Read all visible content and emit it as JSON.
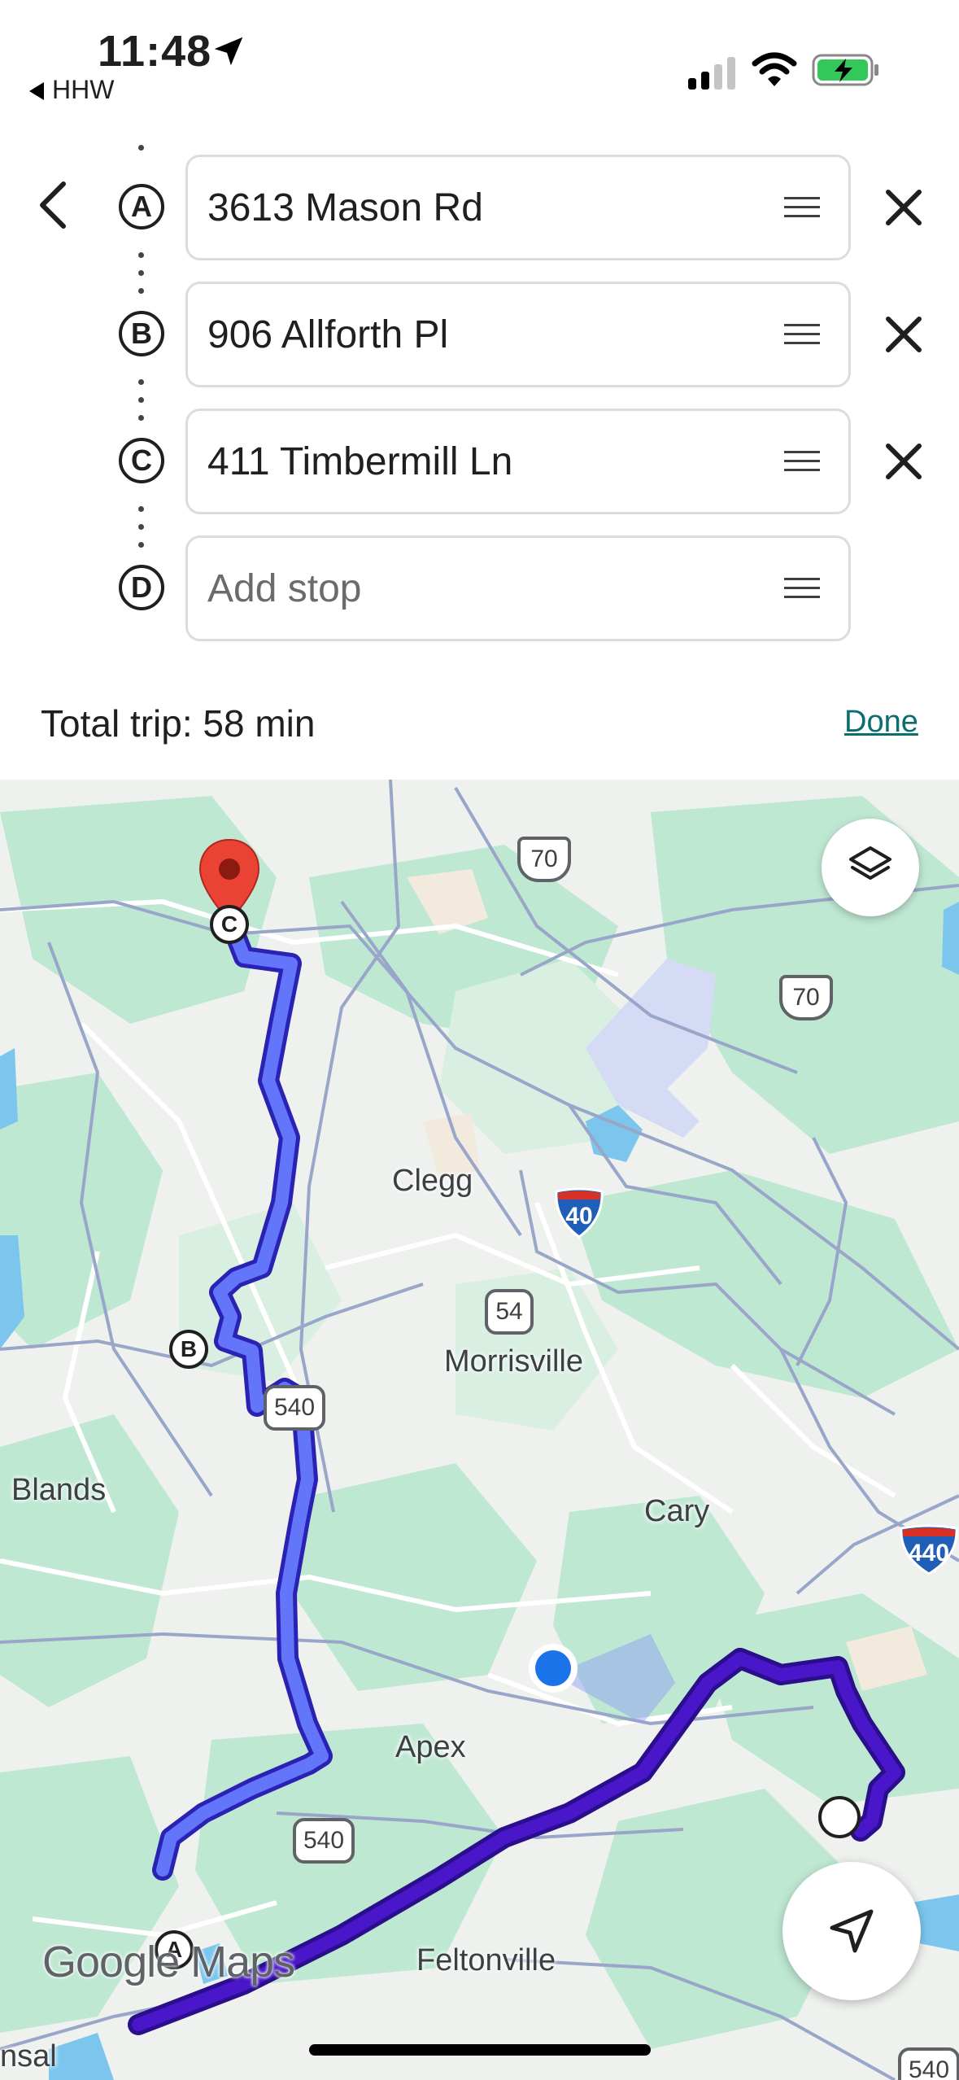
{
  "status_bar": {
    "time": "11:48",
    "back_app": "HHW"
  },
  "directions": {
    "stops": [
      {
        "letter": "A",
        "value": "3613 Mason Rd"
      },
      {
        "letter": "B",
        "value": "906 Allforth Pl"
      },
      {
        "letter": "C",
        "value": "411 Timbermill Ln"
      }
    ],
    "add_stop": {
      "letter": "D",
      "placeholder": "Add stop"
    },
    "total_trip": "Total trip: 58 min",
    "done_label": "Done"
  },
  "map": {
    "places": {
      "blands": "Blands",
      "clegg": "Clegg",
      "morrisville": "Morrisville",
      "cary": "Cary",
      "apex": "Apex",
      "feltonville": "Feltonville",
      "nsal": "nsal"
    },
    "routes": {
      "us70_a": "70",
      "us70_b": "70",
      "i40": "40",
      "nc54": "54",
      "nc540_a": "540",
      "nc540_b": "540",
      "i440": "440",
      "nc540_c": "540"
    },
    "markers": {
      "b": "B",
      "c": "C",
      "a": "A"
    },
    "logo": "Google Maps",
    "colors": {
      "route_main": "#5b6cf7",
      "route_alt": "#4a16c9",
      "pin": "#ea4335",
      "you": "#1a73e8"
    }
  }
}
